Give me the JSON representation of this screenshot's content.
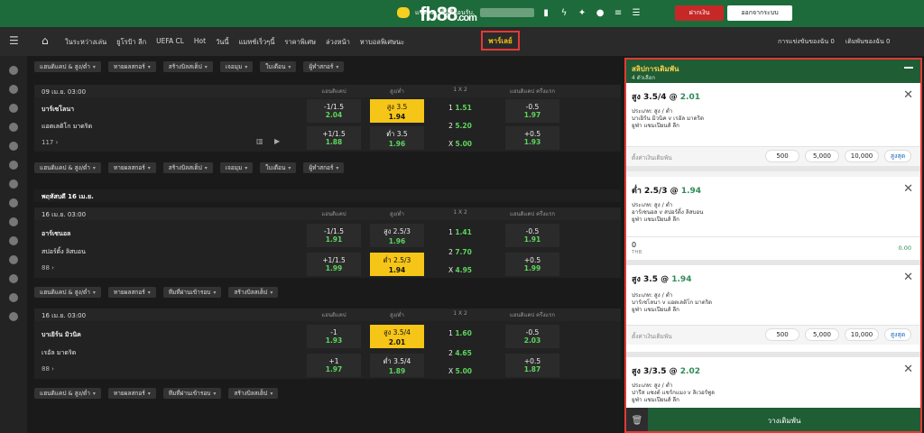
{
  "header": {
    "logo_main": "fb88",
    "logo_suffix": ".com",
    "chat_label": "แชทสด",
    "welcome": "ยินดีต้อนรับ,",
    "icons": [
      "chat-icon",
      "file-icon",
      "lightning-icon",
      "promo-icon",
      "user-icon",
      "list-icon",
      "menu-icon"
    ],
    "deposit_label": "ฝากเงิน",
    "logout_label": "ออกจากระบบ"
  },
  "nav": {
    "items": [
      "ในระหว่างเล่น",
      "ยูโรป้า ลีก",
      "UEFA CL",
      "Hot",
      "วันนี้",
      "แมทช์เร็วๆนี้",
      "ราคาพิเศษ",
      "ล่วงหน้า",
      "หาบอลพิเศษนะ"
    ],
    "active": "พาร์เลย์",
    "right": [
      "การแข่งขันของฉัน 0",
      "เดิมพันของฉัน 0"
    ]
  },
  "chips": {
    "row1": [
      "แฮนดิแคป & สูง/ต่ำ",
      "ทายผลสกอร์",
      "สร้างบิลสเต็ป",
      "เจอมุม",
      "ใบเตือน",
      "ผู้ทำสกอร์"
    ],
    "row3": [
      "แฮนดิแคป & สูง/ต่ำ",
      "ทายผลสกอร์",
      "ทีมที่ผ่านเข้ารอบ",
      "สร้างบิลสเต็ป"
    ]
  },
  "columns": [
    "แฮนดิแคป",
    "สูง/ต่ำ",
    "1 X 2",
    "แฮนดิแคป ครึ่งแรก"
  ],
  "day_label": "พฤหัสบดี 16 เม.ย.",
  "matches": [
    {
      "time": "09 เม.ย. 03:00",
      "home": "บาร์เซโลนา",
      "away": "แอตเลติโก มาดริด",
      "more": "117 ›",
      "hdp": [
        [
          "-1/1.5",
          "2.04"
        ],
        [
          "+1/1.5",
          "1.88"
        ]
      ],
      "ou": [
        [
          "สูง 3.5",
          "1.94"
        ],
        [
          "ต่ำ 3.5",
          "1.96"
        ]
      ],
      "x12": [
        [
          "1",
          "1.51"
        ],
        [
          "2",
          "5.20"
        ],
        [
          "X",
          "5.00"
        ]
      ],
      "fh": [
        [
          "-0.5",
          "1.97"
        ],
        [
          "+0.5",
          "1.93"
        ]
      ]
    },
    {
      "time": "16 เม.ย. 03:00",
      "home": "อาร์เซนอล",
      "away": "สปอร์ติ้ง ลิสบอน",
      "more": "88 ›",
      "hdp": [
        [
          "-1/1.5",
          "1.91"
        ],
        [
          "+1/1.5",
          "1.99"
        ]
      ],
      "ou": [
        [
          "สูง 2.5/3",
          "1.96"
        ],
        [
          "ต่ำ 2.5/3",
          "1.94"
        ]
      ],
      "x12": [
        [
          "1",
          "1.41"
        ],
        [
          "2",
          "7.70"
        ],
        [
          "X",
          "4.95"
        ]
      ],
      "fh": [
        [
          "-0.5",
          "1.91"
        ],
        [
          "+0.5",
          "1.99"
        ]
      ]
    },
    {
      "time": "16 เม.ย. 03:00",
      "home": "บาเยิร์น มิวนิค",
      "away": "เรอัล มาดริด",
      "more": "88 ›",
      "hdp": [
        [
          "-1",
          "1.93"
        ],
        [
          "+1",
          "1.97"
        ]
      ],
      "ou": [
        [
          "สูง 3.5/4",
          "2.01"
        ],
        [
          "ต่ำ 3.5/4",
          "1.89"
        ]
      ],
      "x12": [
        [
          "1",
          "1.60"
        ],
        [
          "2",
          "4.65"
        ],
        [
          "X",
          "5.00"
        ]
      ],
      "fh": [
        [
          "-0.5",
          "2.03"
        ],
        [
          "+0.5",
          "1.87"
        ]
      ]
    }
  ],
  "slip": {
    "title": "สลิปการเดิมพัน",
    "subtitle": "4 ตัวเลือก",
    "bets": [
      {
        "sel": "สูง  3.5/4",
        "at": "@",
        "odds": "2.01",
        "l1": "ประเภท: สูง / ต่ำ",
        "l2": "บาเยิร์น มิวนิค v เรอัล มาดริด",
        "l3": "ยูฟ่า แชมเปียนส์ ลีก"
      },
      {
        "sel": "ต่ำ  2.5/3",
        "at": "@",
        "odds": "1.94",
        "l1": "ประเภท: สูง / ต่ำ",
        "l2": "อาร์เซนอล v สปอร์ติ้ง ลิสบอน",
        "l3": "ยูฟ่า แชมเปียนส์ ลีก"
      },
      {
        "sel": "สูง  3.5",
        "at": "@",
        "odds": "1.94",
        "l1": "ประเภท: สูง / ต่ำ",
        "l2": "บาร์เซโลนา v แอตเลติโก มาดริด",
        "l3": "ยูฟ่า แชมเปียนส์ ลีก"
      },
      {
        "sel": "สูง  3/3.5",
        "at": "@",
        "odds": "2.02",
        "l1": "ประเภท: สูง / ต่ำ",
        "l2": "ปารีส แซงต์ แชร์กแมง v ลิเวอร์พูล",
        "l3": "ยูฟ่า แชมเปียนส์ ลีก"
      }
    ],
    "stake_label": "ตั้งค่าเงินเดิมพัน",
    "quick": [
      "500",
      "5,000",
      "10,000"
    ],
    "max_label": "สูงสุด",
    "stake_value": "0",
    "currency": "THB",
    "stake_right": "0.00",
    "place_label": "วางเดิมพัน"
  }
}
